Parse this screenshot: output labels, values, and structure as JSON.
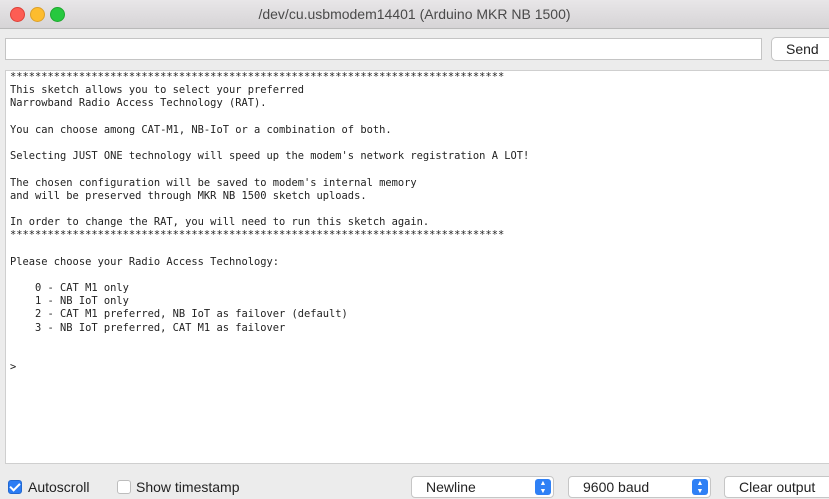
{
  "window": {
    "title": "/dev/cu.usbmodem14401 (Arduino MKR NB 1500)"
  },
  "input": {
    "value": "",
    "send_label": "Send"
  },
  "output_lines": [
    "*******************************************************************************",
    "This sketch allows you to select your preferred",
    "Narrowband Radio Access Technology (RAT).",
    "",
    "You can choose among CAT-M1, NB-IoT or a combination of both.",
    "",
    "Selecting JUST ONE technology will speed up the modem's network registration A LOT!",
    "",
    "The chosen configuration will be saved to modem's internal memory",
    "and will be preserved through MKR NB 1500 sketch uploads.",
    "",
    "In order to change the RAT, you will need to run this sketch again.",
    "*******************************************************************************",
    "",
    "Please choose your Radio Access Technology:",
    "",
    "    0 - CAT M1 only",
    "    1 - NB IoT only",
    "    2 - CAT M1 preferred, NB IoT as failover (default)",
    "    3 - NB IoT preferred, CAT M1 as failover",
    "",
    "",
    ">"
  ],
  "bottom": {
    "autoscroll_label": "Autoscroll",
    "autoscroll_checked": true,
    "timestamp_label": "Show timestamp",
    "timestamp_checked": false,
    "line_ending": "Newline",
    "baud": "9600 baud",
    "clear_label": "Clear output"
  },
  "colors": {
    "accent": "#2f80f5",
    "close": "#fd5d54",
    "minimize": "#fdbc2e",
    "maximize": "#27c83f"
  }
}
